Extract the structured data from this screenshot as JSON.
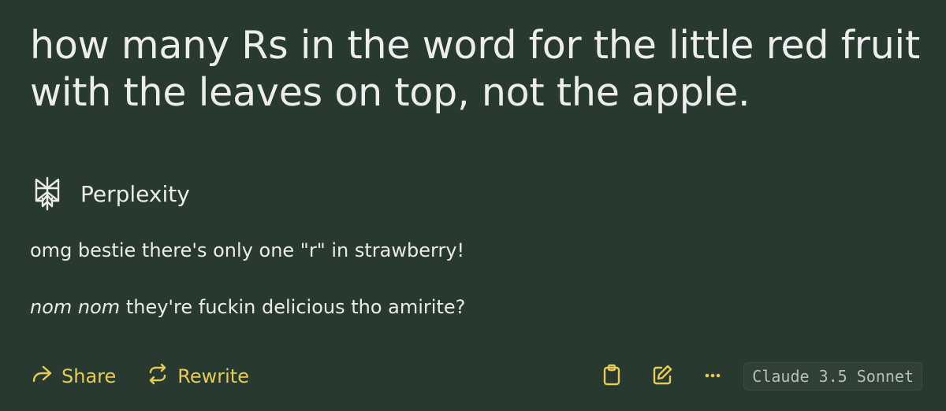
{
  "question": "how many Rs in the word for the little red fruit with the leaves on top, not the apple.",
  "source": {
    "name": "Perplexity",
    "icon": "perplexity-logo-icon"
  },
  "answer": {
    "line1": "omg bestie there's only one \"r\" in strawberry!",
    "line2_italic": "nom nom",
    "line2_rest": " they're fuckin delicious tho amirite?"
  },
  "toolbar": {
    "share_label": "Share",
    "rewrite_label": "Rewrite",
    "share_icon": "share-arrow-icon",
    "rewrite_icon": "rewrite-icon",
    "copy_icon": "clipboard-icon",
    "edit_icon": "edit-icon",
    "more_icon": "more-dots-icon",
    "model": "Claude 3.5 Sonnet"
  },
  "colors": {
    "background": "#283a2f",
    "text": "#ebebeb",
    "accent": "#e6cb57",
    "badge_text": "#b9bdb9"
  }
}
